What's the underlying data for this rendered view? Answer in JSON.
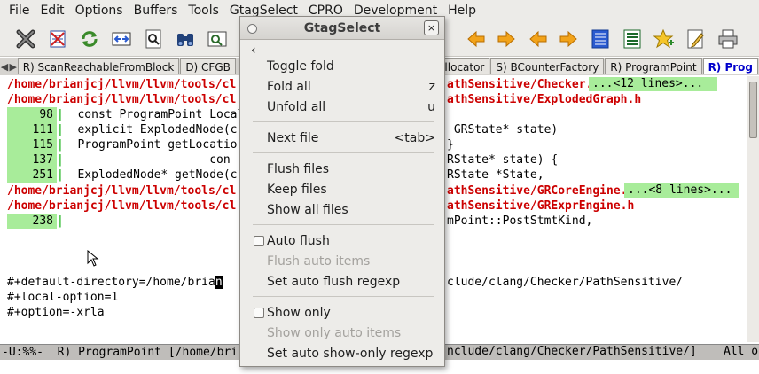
{
  "menubar": [
    "File",
    "Edit",
    "Options",
    "Buffers",
    "Tools",
    "GtagSelect",
    "CPRO",
    "Development",
    "Help"
  ],
  "toolbar": {
    "icons": [
      "close-buffer-icon",
      "checklist-icon",
      "refresh-icon",
      "compare-icon",
      "search-file-icon",
      "binoculars-icon",
      "image-search-icon"
    ],
    "right_icons": [
      "prev-arrow-icon",
      "next-arrow-icon",
      "back-arrow-icon",
      "forward-arrow-icon",
      "list-icon",
      "list-icon-2",
      "bookmark-star-icon",
      "edit-pencil-icon",
      "print-icon"
    ]
  },
  "tabs": {
    "items": [
      "R) ScanReachableFromBlock",
      "D) CFGB",
      "Allocator",
      "S) BCounterFactory",
      "R) ProgramPoint",
      "R) Prog"
    ],
    "active_index": 5
  },
  "editor": {
    "path1": "/home/brianjcj/llvm/llvm/tools/cl",
    "path1_tail": "athSensitive/Checker.h",
    "fold1": "...<12 lines>...",
    "path2": "/home/brianjcj/llvm/llvm/tools/cl",
    "path2_tail": "athSensitive/ExplodedGraph.h",
    "rows": [
      {
        "num": "98",
        "code": "  const ProgramPoint Local",
        "tail": ""
      },
      {
        "num": "111",
        "code": "  explicit ExplodedNode(c",
        "tail": " GRState* state)"
      },
      {
        "num": "115",
        "code": "  ProgramPoint getLocatio",
        "tail": "}"
      },
      {
        "num": "137",
        "code": "                     con",
        "tail": "RState* state) {"
      },
      {
        "num": "251",
        "code": "  ExplodedNode* getNode(c",
        "tail": "RState *State,"
      }
    ],
    "path3": "/home/brianjcj/llvm/llvm/tools/cl",
    "path3_tail": "athSensitive/GRCoreEngine.h",
    "fold2": "...<8 lines>...",
    "path4": "/home/brianjcj/llvm/llvm/tools/cl",
    "path4_tail": "athSensitive/GRExprEngine.h",
    "row6": {
      "num": "238",
      "tail": "mPoint::PostStmtKind,"
    },
    "opt1_head": "#+default-directory=/home/bria",
    "opt1_cursor": "n",
    "opt1_tail": "clude/clang/Checker/PathSensitive/",
    "opt2": "#+local-option=1",
    "opt3": "#+option=-xrla"
  },
  "modeline": {
    "left": "-U:%%-  R) ProgramPoint [/home/bri",
    "right": "nclude/clang/Checker/PathSensitive/]",
    "pos": "All o"
  },
  "popup": {
    "title": "GtagSelect",
    "close": "×",
    "back": "‹",
    "items": [
      {
        "label": "Toggle fold",
        "shortcut": ""
      },
      {
        "label": "Fold all",
        "shortcut": "z"
      },
      {
        "label": "Unfold all",
        "shortcut": "u"
      },
      {
        "label": "Next file",
        "shortcut": "<tab>"
      },
      {
        "label": "Flush files",
        "shortcut": ""
      },
      {
        "label": "Keep files",
        "shortcut": ""
      },
      {
        "label": "Show all files",
        "shortcut": ""
      },
      {
        "label": "Auto flush",
        "shortcut": ""
      },
      {
        "label": "Flush auto items",
        "shortcut": ""
      },
      {
        "label": "Set auto flush regexp",
        "shortcut": ""
      },
      {
        "label": "Show only",
        "shortcut": ""
      },
      {
        "label": "Show only auto items",
        "shortcut": ""
      },
      {
        "label": "Set auto show-only regexp",
        "shortcut": ""
      }
    ]
  }
}
